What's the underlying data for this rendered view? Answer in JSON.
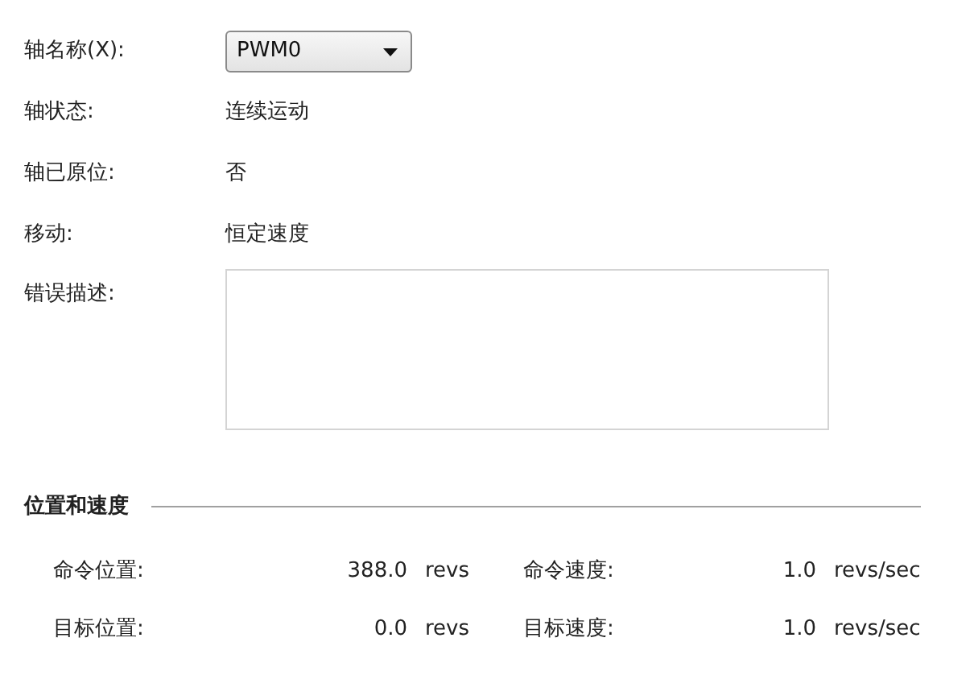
{
  "axis_name": {
    "label": "轴名称(X):",
    "value": "PWM0"
  },
  "fields": [
    {
      "label": "轴状态:",
      "value": "连续运动"
    },
    {
      "label": "轴已原位:",
      "value": "否"
    },
    {
      "label": "移动:",
      "value": "恒定速度"
    }
  ],
  "error": {
    "label": "错误描述:"
  },
  "section": {
    "title": "位置和速度",
    "readings": [
      {
        "label": "命令位置:",
        "value": "388.0",
        "unit": "revs"
      },
      {
        "label": "命令速度:",
        "value": "1.0",
        "unit": "revs/sec"
      },
      {
        "label": "目标位置:",
        "value": "0.0",
        "unit": "revs"
      },
      {
        "label": "目标速度:",
        "value": "1.0",
        "unit": "revs/sec"
      }
    ]
  }
}
